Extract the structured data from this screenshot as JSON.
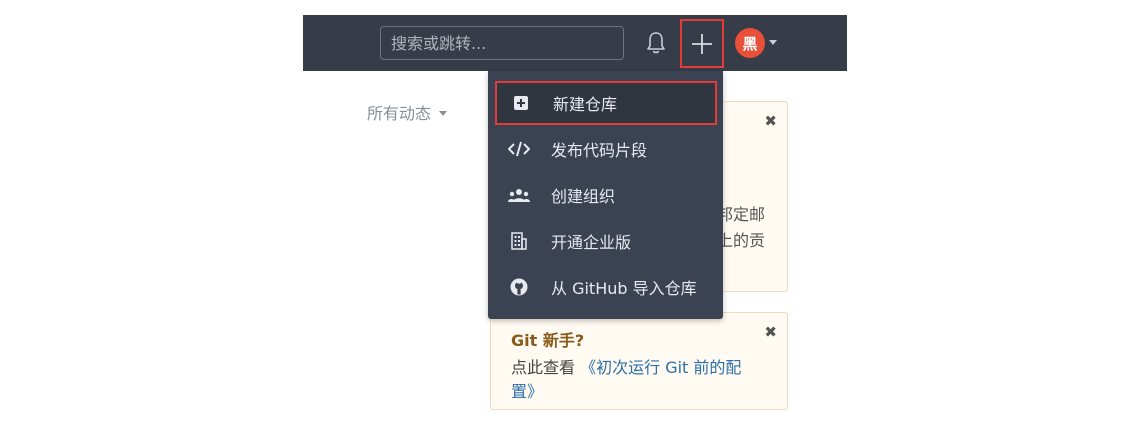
{
  "header": {
    "search_placeholder": "搜索或跳转...",
    "avatar_text": "黑"
  },
  "feed": {
    "filter_label": "所有动态"
  },
  "new_menu": {
    "items": [
      {
        "label": "新建仓库",
        "icon": "plus-square-icon"
      },
      {
        "label": "发布代码片段",
        "icon": "code-icon"
      },
      {
        "label": "创建组织",
        "icon": "group-icon"
      },
      {
        "label": "开通企业版",
        "icon": "building-icon"
      },
      {
        "label": "从 GitHub 导入仓库",
        "icon": "github-icon"
      }
    ]
  },
  "notice_card": {
    "line1": "邦定邮",
    "line2": "上的贡"
  },
  "git_card": {
    "title": "Git 新手?",
    "text": "点此查看",
    "link": "《初次运行 Git 前的配置》"
  },
  "colors": {
    "topbar": "#363c48",
    "dropdown": "#3b4252",
    "highlight_border": "#e23b3b",
    "avatar": "#e8503a",
    "card_bg": "#fffaf2"
  }
}
